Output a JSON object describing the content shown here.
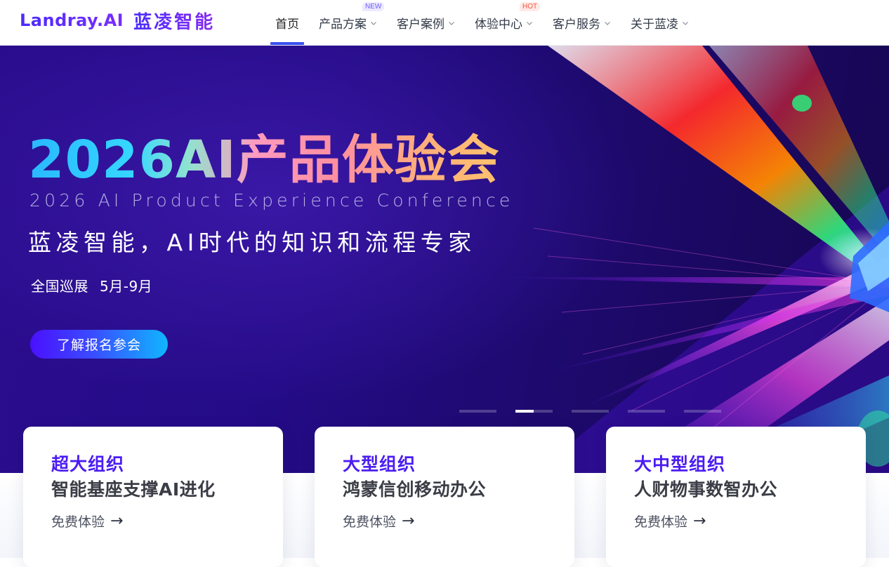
{
  "header": {
    "logo_en": "Landray.AI",
    "logo_cn": "蓝凌智能",
    "nav": [
      {
        "label": "首页",
        "active": true
      },
      {
        "label": "产品方案",
        "badge": "NEW"
      },
      {
        "label": "客户案例"
      },
      {
        "label": "体验中心",
        "badge": "HOT"
      },
      {
        "label": "客户服务"
      },
      {
        "label": "关于蓝凌"
      }
    ]
  },
  "hero": {
    "title": "2026AI产品体验会",
    "subtitle_en": "2026 AI Product Experience Conference",
    "tagline": "蓝凌智能，AI时代的知识和流程专家",
    "tour": "全国巡展",
    "date": "5月-9月",
    "cta": "了解报名参会",
    "carousel": {
      "count": 5,
      "active_index": 1
    }
  },
  "cards": [
    {
      "tag": "超大组织",
      "title": "智能基座支撑AI进化",
      "link": "免费体验"
    },
    {
      "tag": "大型组织",
      "title": "鸿蒙信创移动办公",
      "link": "免费体验"
    },
    {
      "tag": "大中型组织",
      "title": "人财物事数智办公",
      "link": "免费体验"
    }
  ],
  "icons": {
    "nav_dropdown": "chevron-down-icon",
    "card_link": "arrow-right-icon"
  },
  "colors": {
    "brand": "#4b1cf2",
    "nav_active": "#3c4ff2",
    "hero_bg": "#240b86",
    "badge_new": "#6f5cf6",
    "badge_hot": "#f2563f"
  }
}
